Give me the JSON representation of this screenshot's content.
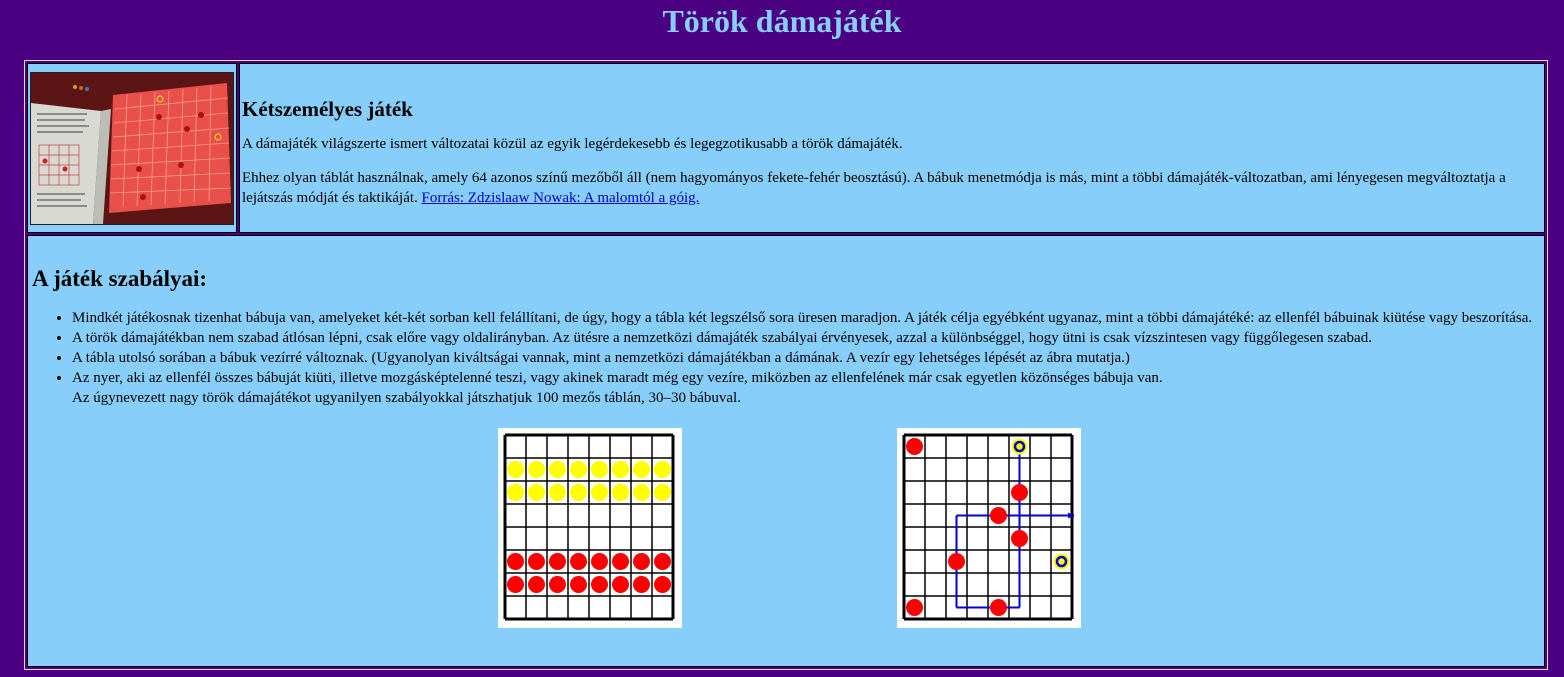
{
  "page": {
    "title": "Török dámajáték"
  },
  "intro": {
    "heading": "Kétszemélyes játék",
    "paragraph1": "A dámajáték világszerte ismert változatai közül az egyik legérdekesebb és legegzotikusabb a török dámajáték.",
    "paragraph2": "Ehhez olyan táblát használnak, amely 64 azonos színű mezőből áll (nem hagyományos fekete-fehér beosztású). A bábuk menetmódja is más, mint a többi dámajáték-változatban, ami lényegesen megváltoztatja a lejátszás módját és taktikáját.",
    "source_link": "Forrás: Zdzislaaw Nowak: A malomtól a góig."
  },
  "rules": {
    "heading": "A játék szabályai:",
    "items": [
      "Mindkét játékosnak tizenhat bábuja van, amelyeket két-két sorban kell felállítani, de úgy, hogy a tábla két legszélső sora üresen maradjon. A játék célja egyébként ugyanaz, mint a többi dámajátéké: az ellenfél bábuinak kiütése vagy beszorítása.",
      "A török dámajátékban nem szabad átlósan lépni, csak előre vagy oldalirányban. Az ütésre a nemzetközi dámajáték szabályai érvényesek, azzal a különbséggel, hogy ütni is csak vízszintesen vagy függőlegesen szabad.",
      "A tábla utolsó sorában a bábuk vezírré változnak. (Ugyanolyan kiváltságai vannak, mint a nemzetközi dámajátékban a dámának. A vezír egy lehetséges lépését az ábra mutatja.)",
      "Az nyer, aki az ellenfél összes bábuját kiüti, illetve mozgásképtelenné teszi, vagy akinek maradt még egy vezíre, miközben az ellenfelének már csak egyetlen közönséges bábuja van."
    ],
    "extra_line": "Az úgynevezett nagy török dámajátékot ugyanilyen szabályokkal játszhatjuk 100 mezős táblán, 30–30 bábuval."
  },
  "colors": {
    "background": "#4b0082",
    "panel": "#87cefa",
    "title": "#87cefa",
    "red_piece": "#ff0000",
    "yellow_piece": "#ffff00",
    "move_line": "#0000cd"
  }
}
